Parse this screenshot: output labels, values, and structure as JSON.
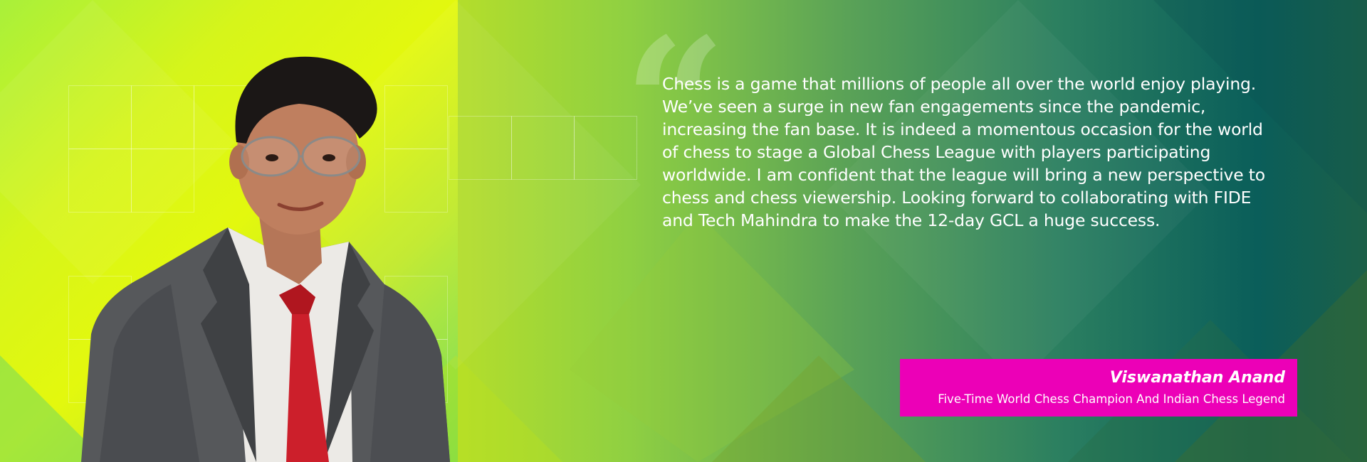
{
  "banner": {
    "quote_mark": "“",
    "quote": "Chess is a game that millions of people all over the world enjoy playing. We’ve seen a surge in new fan engagements since the pandemic, increasing the fan base. It is indeed a momentous occasion for the world of chess to stage a Global Chess League with players participating worldwide. I am confident that the league will bring a new perspective to chess and chess viewership. Looking forward to collaborating with FIDE and Tech Mahindra to make the 12-day GCL a huge success.",
    "person_name": "Viswanathan Anand",
    "person_title": "Five-Time World Chess Champion And Indian Chess Legend",
    "colors": {
      "name_card": "#ec00b7",
      "text": "#ffffff",
      "lime": "#e3f80e",
      "teal": "#0a5e5a"
    },
    "icons": [
      "quote-mark-icon",
      "portrait-image"
    ]
  }
}
